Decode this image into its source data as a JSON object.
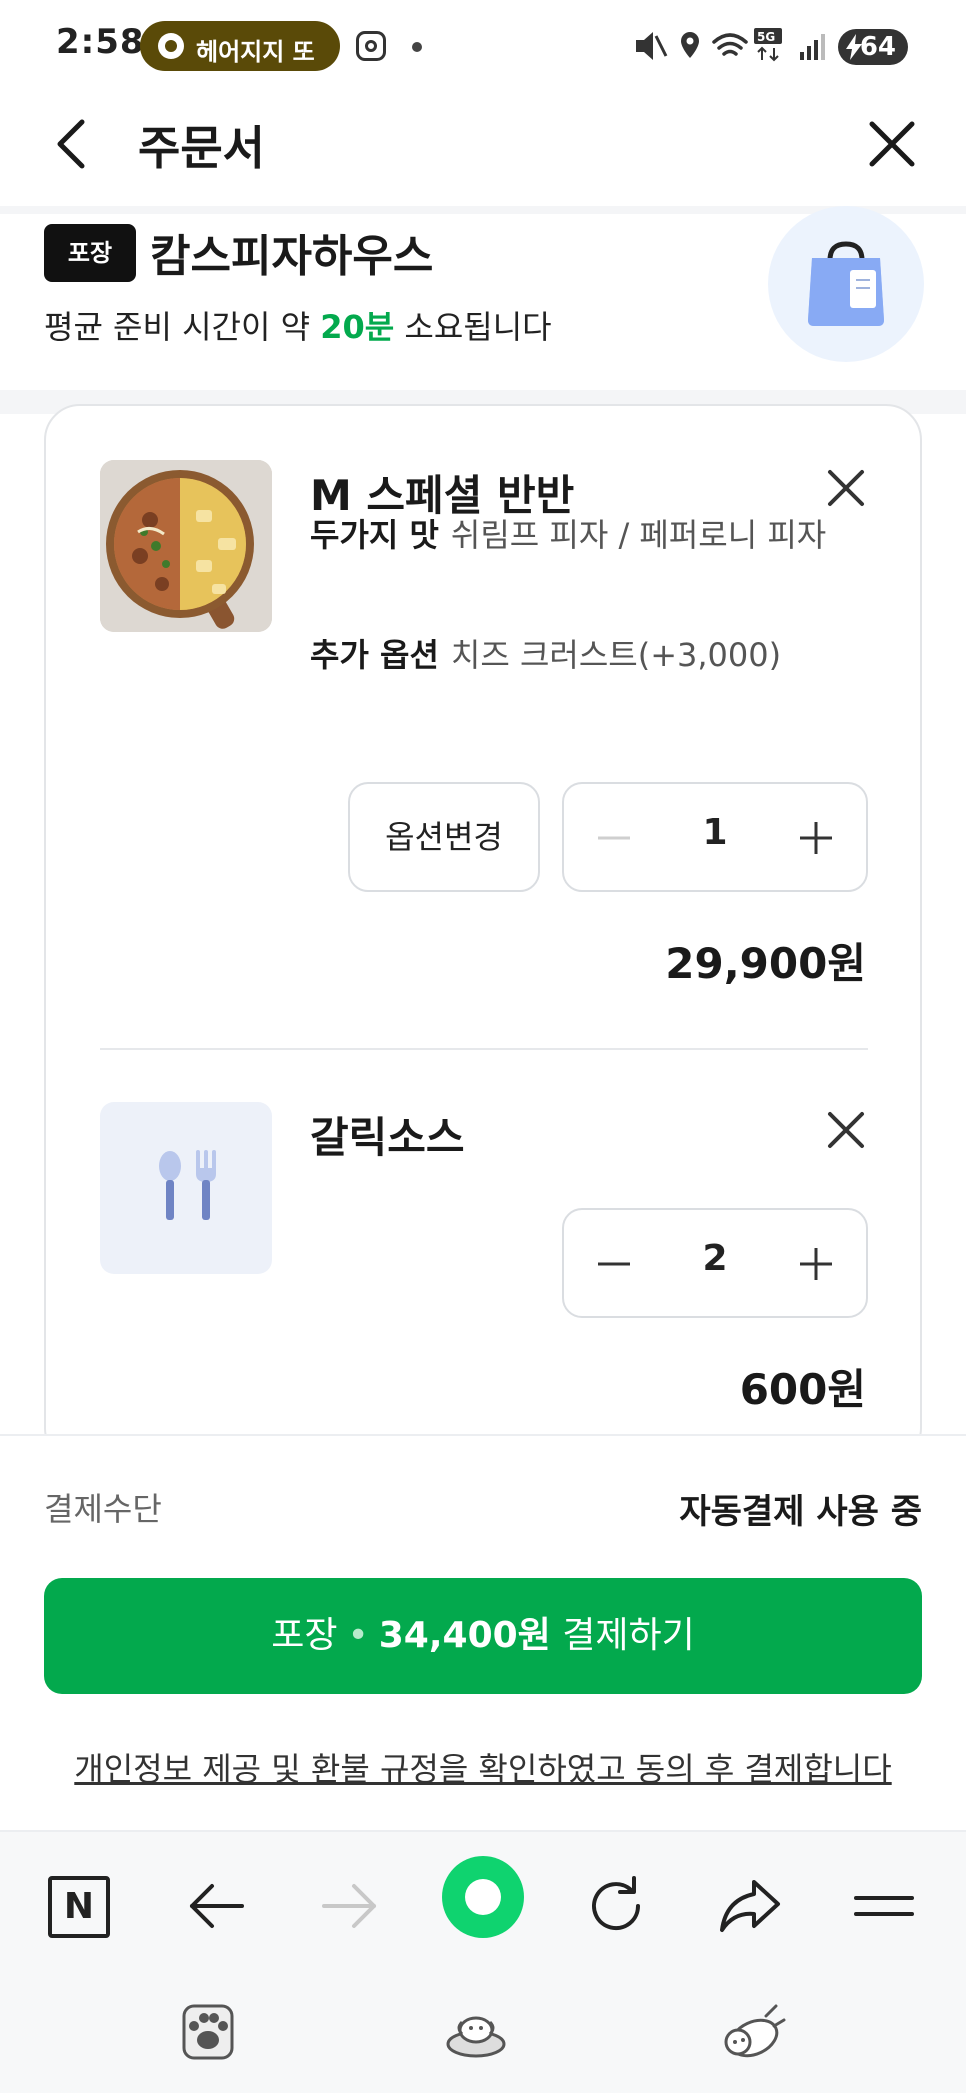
{
  "status_bar": {
    "time": "2:58",
    "notification_app": "헤어지지 \u0000",
    "notification_label": "헤어지지 또",
    "battery": "64",
    "icons": [
      "mute-icon",
      "location-icon",
      "wifi-icon",
      "5g-icon",
      "signal-icon"
    ]
  },
  "header": {
    "title": "주문서"
  },
  "store": {
    "badge": "포장",
    "name": "캄스피자하우스",
    "prep_prefix": "평균 준비 시간이 약 ",
    "prep_time": "20분",
    "prep_suffix": " 소요됩니다"
  },
  "items": [
    {
      "name": "M 스페셜 반반",
      "option1_key": "두가지 맛",
      "option1_value": "쉬림프 피자 / 페퍼로니 피자",
      "option2_key": "추가 옵션",
      "option2_value": "치즈 크러스트(+3,000)",
      "change_label": "옵션변경",
      "quantity": "1",
      "price": "29,900원"
    },
    {
      "name": "갈릭소스",
      "quantity": "2",
      "price": "600원"
    }
  ],
  "payment": {
    "method_label": "결제수단",
    "method_value": "자동결제 사용 중",
    "button_type": "포장",
    "button_amount": "34,400원",
    "button_action": "결제하기",
    "consent": "개인정보 제공 및 환불 규정을 확인하였고 동의 후 결제합니다"
  },
  "browser": {
    "home_letter": "N"
  },
  "colors": {
    "accent_green": "#03a94d",
    "badge_black": "#111111",
    "status_pill": "#5a4a08"
  }
}
